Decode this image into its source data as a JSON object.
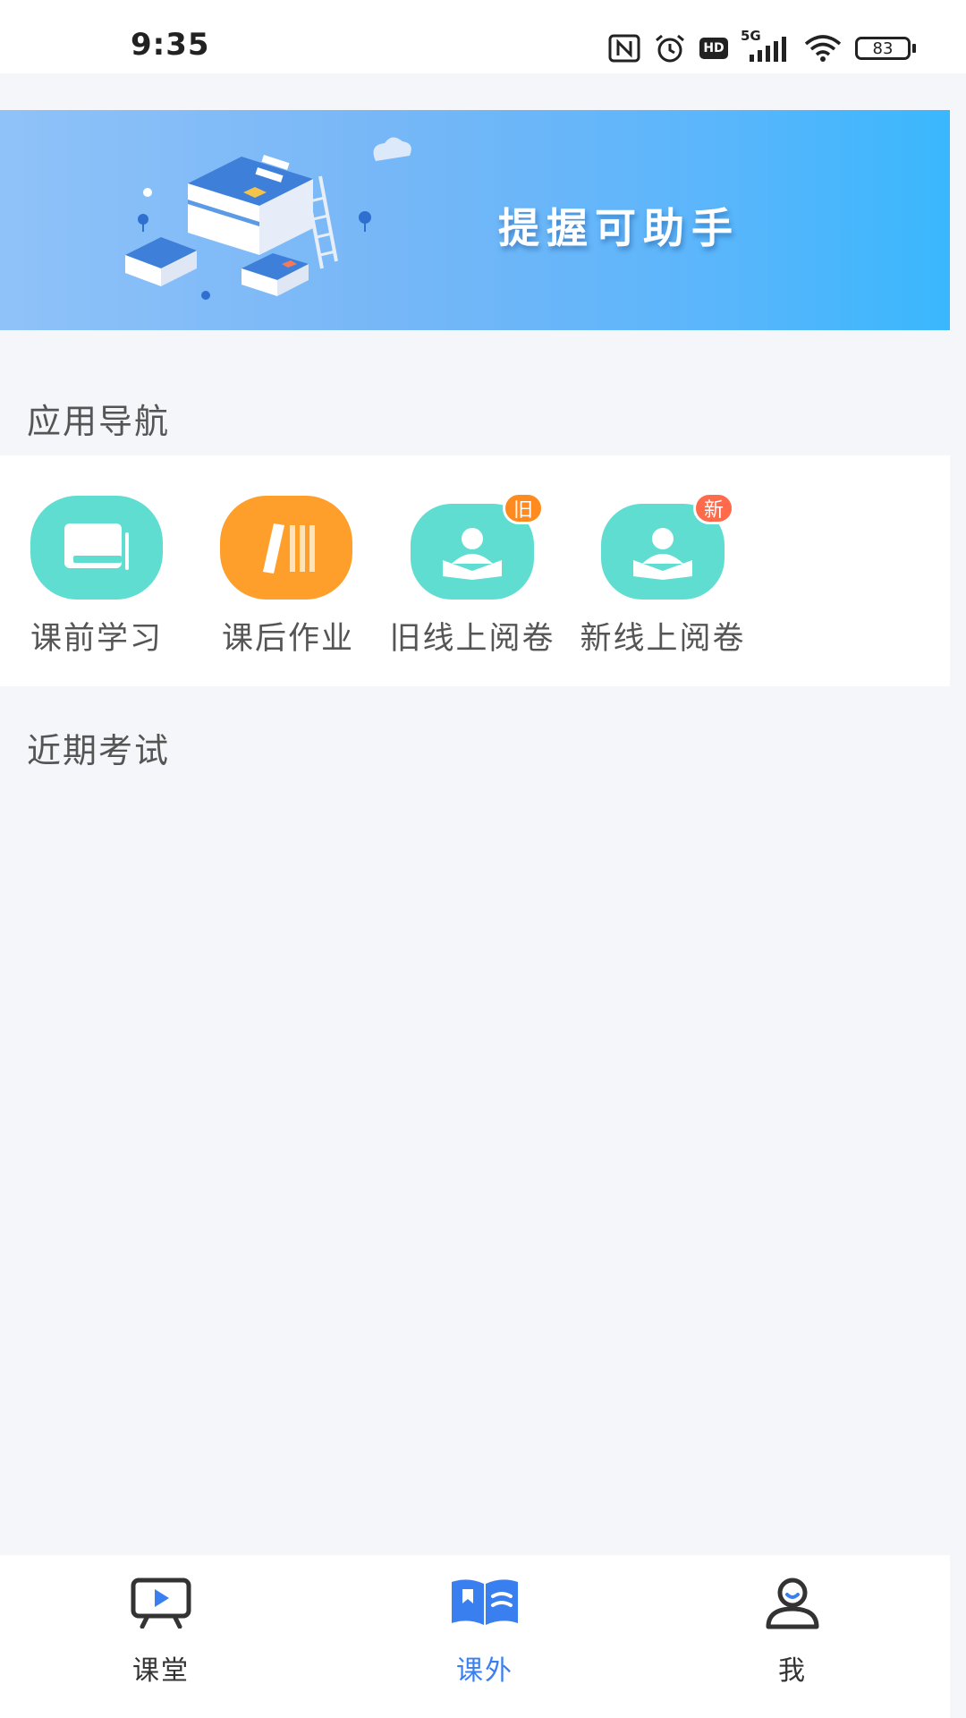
{
  "status_bar": {
    "time": "9:35",
    "network": "5G",
    "hd_label": "HD",
    "battery": "83",
    "icons": [
      "nfc-icon",
      "alarm-icon",
      "hd-icon",
      "signal-icon",
      "wifi-icon",
      "battery-icon"
    ]
  },
  "banner": {
    "title": "提握可助手"
  },
  "sections": {
    "app_nav_title": "应用导航",
    "recent_exams_title": "近期考试"
  },
  "app_nav": {
    "items": [
      {
        "label": "课前学习",
        "icon": "book-icon",
        "color": "#5fddd1"
      },
      {
        "label": "课后作业",
        "icon": "homework-icon",
        "color": "#ff9f2b"
      },
      {
        "label": "旧线上阅卷",
        "icon": "reader-icon",
        "color": "#5fddd1",
        "badge": "旧",
        "badge_color": "#ff8a1e"
      },
      {
        "label": "新线上阅卷",
        "icon": "reader-icon",
        "color": "#5fddd1",
        "badge": "新",
        "badge_color": "#ff6a4a"
      }
    ]
  },
  "bottom_nav": {
    "tabs": [
      {
        "label": "课堂",
        "icon": "classroom-icon",
        "active": false
      },
      {
        "label": "课外",
        "icon": "open-book-icon",
        "active": true
      },
      {
        "label": "我",
        "icon": "person-icon",
        "active": false
      }
    ],
    "active_color": "#3a7ff0"
  }
}
